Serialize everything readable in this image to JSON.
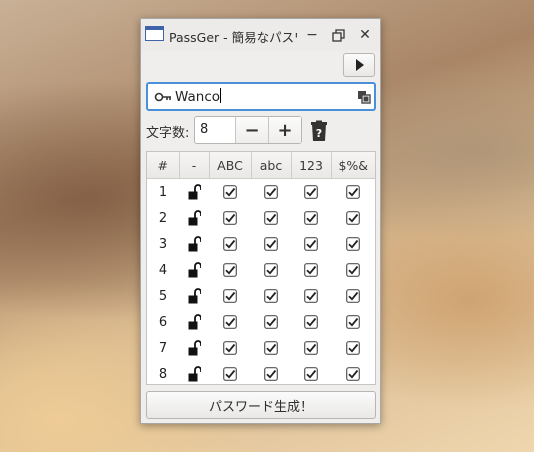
{
  "window": {
    "title": "PassGer - 簡易なパスワ",
    "minimize_label": "−",
    "restore_label": "⧉",
    "close_label": "✕"
  },
  "entry": {
    "value": "Wanco"
  },
  "length": {
    "label": "文字数:",
    "value": "8",
    "decrement_label": "−",
    "increment_label": "+"
  },
  "table": {
    "headers": [
      "#",
      "-",
      "ABC",
      "abc",
      "123",
      "$%&"
    ],
    "rows": [
      {
        "num": "1",
        "locked": false,
        "upper": true,
        "lower": true,
        "digit": true,
        "symbol": true
      },
      {
        "num": "2",
        "locked": false,
        "upper": true,
        "lower": true,
        "digit": true,
        "symbol": true
      },
      {
        "num": "3",
        "locked": false,
        "upper": true,
        "lower": true,
        "digit": true,
        "symbol": true
      },
      {
        "num": "4",
        "locked": false,
        "upper": true,
        "lower": true,
        "digit": true,
        "symbol": true
      },
      {
        "num": "5",
        "locked": false,
        "upper": true,
        "lower": true,
        "digit": true,
        "symbol": true
      },
      {
        "num": "6",
        "locked": false,
        "upper": true,
        "lower": true,
        "digit": true,
        "symbol": true
      },
      {
        "num": "7",
        "locked": false,
        "upper": true,
        "lower": true,
        "digit": true,
        "symbol": true
      },
      {
        "num": "8",
        "locked": false,
        "upper": true,
        "lower": true,
        "digit": true,
        "symbol": true
      }
    ]
  },
  "generate_button": {
    "label": "パスワード生成！"
  },
  "icons": {
    "app": "window-icon",
    "play": "play-icon",
    "key": "key-icon",
    "copy": "copy-icon",
    "help": "help-icon",
    "lock": "unlocked-padlock-icon",
    "check": "checkbox-checked-icon"
  },
  "colors": {
    "focus": "#4a90d9",
    "window_bg": "#efeeec"
  }
}
